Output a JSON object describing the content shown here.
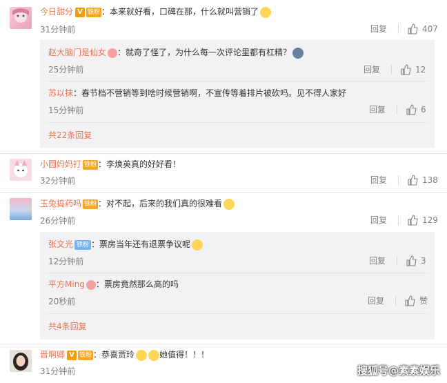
{
  "comments": [
    {
      "user": "今日甜分",
      "badge": "铁粉",
      "text": "：本来就好看，口碑在那，什么就叫营销了",
      "time": "31分钟前",
      "reply_label": "回复",
      "likes": "407",
      "replies": [
        {
          "user": "赵大脑门是仙女",
          "text": "：就奇了怪了，为什么每一次评论里都有杠精？",
          "time": "25分钟前",
          "reply_label": "回复",
          "likes": "12"
        },
        {
          "user": "苏以抹",
          "text": "：春节档不营销等到啥时候营销啊，不宣传等着排片被砍吗。见不得人家好",
          "time": "15分钟前",
          "reply_label": "回复",
          "likes": "6"
        }
      ],
      "more_label": "共22条回复"
    },
    {
      "user": "小圆妈妈打",
      "badge": "铁粉",
      "text": "：李焕英真的好好看！",
      "time": "32分钟前",
      "reply_label": "回复",
      "likes": "138"
    },
    {
      "user": "玉兔捣药吗",
      "badge": "铁粉",
      "text": "：对不起，后来的我们真的很难看",
      "time": "26分钟前",
      "reply_label": "回复",
      "likes": "129",
      "replies": [
        {
          "user": "张文光",
          "badge": "铁粉",
          "text": "：票房当年还有退票争议呢",
          "time": "12分钟前",
          "reply_label": "回复",
          "likes": "3"
        },
        {
          "user": "平方Ming",
          "text": "：票房竟然那么高的吗",
          "time": "20秒前",
          "reply_label": "回复",
          "likes": "赞"
        }
      ],
      "more_label": "共4条回复"
    },
    {
      "user": "晋啊卿",
      "badge": "铁粉",
      "text_before": "：恭喜贾玲",
      "text_after": "她值得！！！",
      "time": "31分钟前"
    }
  ],
  "watermark": "搜狐号@素素娱乐",
  "colors": {
    "username": "#eb7350",
    "reply_bg": "#f2f2f5",
    "muted": "#808080"
  }
}
